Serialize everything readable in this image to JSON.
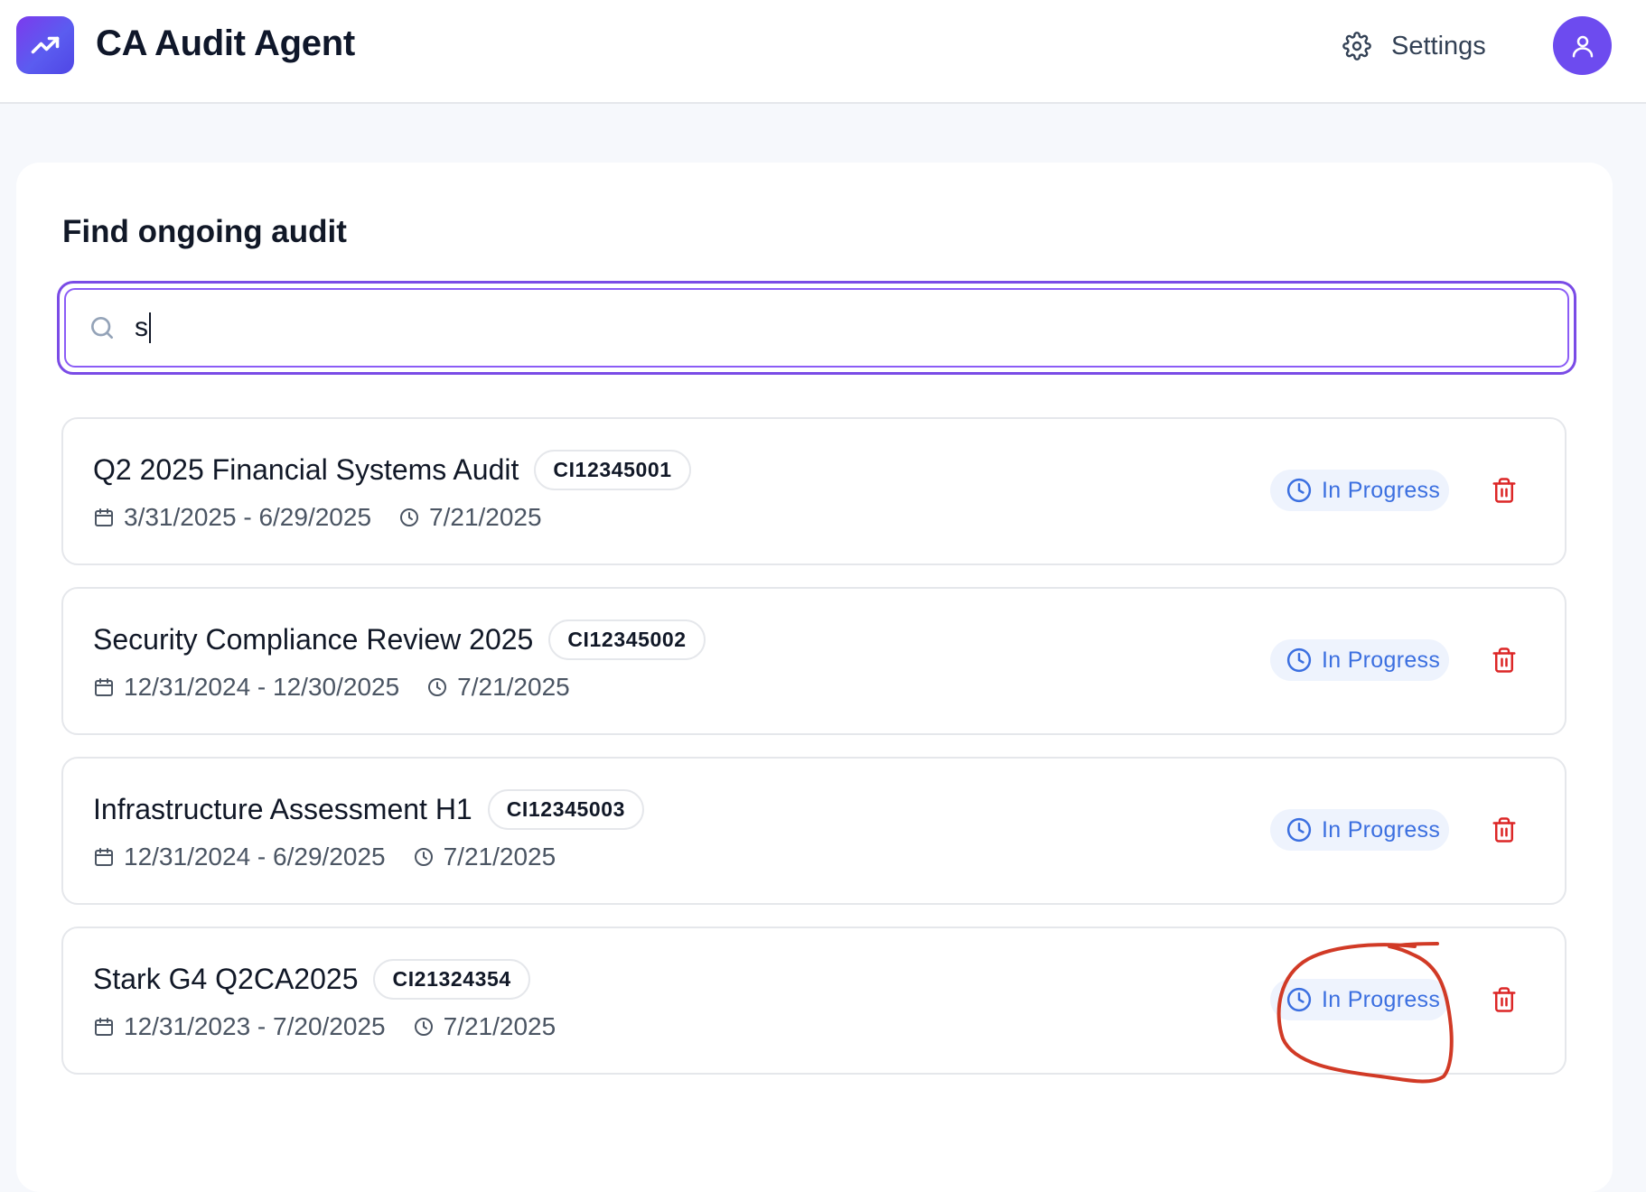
{
  "app": {
    "title": "CA Audit Agent",
    "logo_icon": "trending-up-icon",
    "settings_label": "Settings",
    "settings_icon": "gear-icon",
    "avatar_icon": "user-icon",
    "brand_color": "#6d4bef"
  },
  "search": {
    "heading": "Find ongoing audit",
    "value": "s",
    "icon": "search-icon"
  },
  "audits": [
    {
      "title": "Q2 2025 Financial Systems Audit",
      "code": "CI12345001",
      "period": "3/31/2025 - 6/29/2025",
      "updated": "7/21/2025",
      "status": "In Progress"
    },
    {
      "title": "Security Compliance Review 2025",
      "code": "CI12345002",
      "period": "12/31/2024 - 12/30/2025",
      "updated": "7/21/2025",
      "status": "In Progress"
    },
    {
      "title": "Infrastructure Assessment H1",
      "code": "CI12345003",
      "period": "12/31/2024 - 6/29/2025",
      "updated": "7/21/2025",
      "status": "In Progress"
    },
    {
      "title": "Stark G4 Q2CA2025",
      "code": "CI21324354",
      "period": "12/31/2023 - 7/20/2025",
      "updated": "7/21/2025",
      "status": "In Progress"
    }
  ],
  "colors": {
    "status_text": "#3b6fe0",
    "status_bg": "#eef3fd",
    "delete": "#dc2626",
    "annotation": "#d13a26"
  }
}
